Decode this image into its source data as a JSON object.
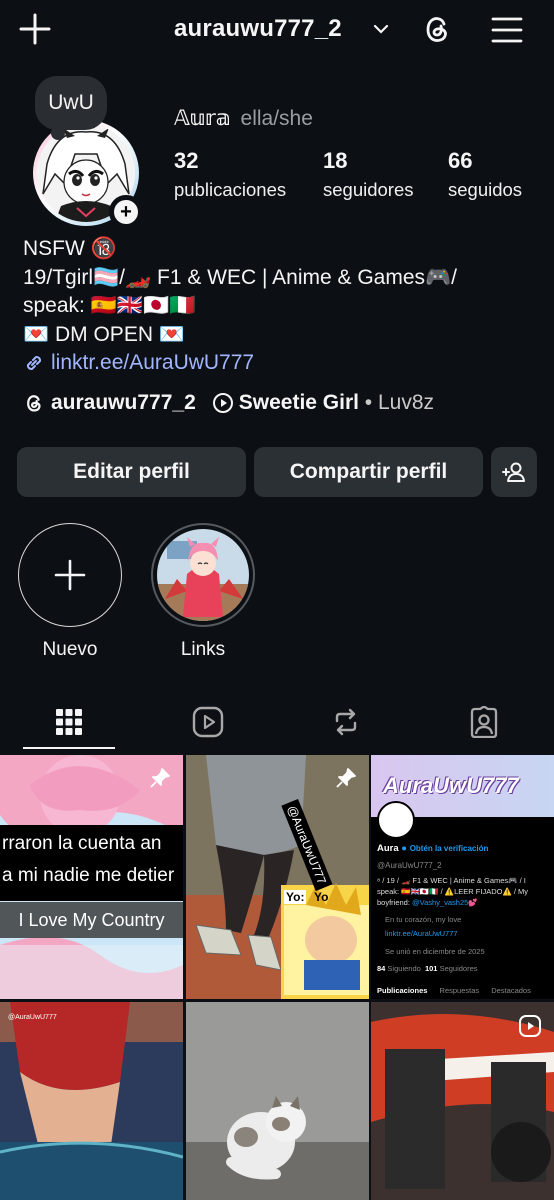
{
  "header": {
    "username": "aurauwu777_2"
  },
  "note": {
    "text": "UwU"
  },
  "profile": {
    "display_name": "𝔸𝕦𝕣𝕒",
    "pronouns": "ella/she"
  },
  "stats": [
    {
      "value": "32",
      "label": "publicaciones"
    },
    {
      "value": "18",
      "label": "seguidores"
    },
    {
      "value": "66",
      "label": "seguidos"
    }
  ],
  "bio": {
    "line1": "NSFW 🔞",
    "line2": "19/Tgirl🏳️‍⚧️/🏎️ F1 & WEC | Anime & Games🎮/",
    "line3": "speak: 🇪🇸🇬🇧🇯🇵🇮🇹",
    "line4": "💌 DM OPEN 💌",
    "link": "linktr.ee/AuraUwU777"
  },
  "meta": {
    "threads_handle": "aurauwu777_2",
    "song_title": "Sweetie Girl",
    "song_sep": " • ",
    "song_artist": "Luv8z"
  },
  "buttons": {
    "edit": "Editar perfil",
    "share": "Compartir perfil"
  },
  "highlights": [
    {
      "label": "Nuevo"
    },
    {
      "label": "Links"
    }
  ],
  "posts": {
    "p1_text1": "rraron la cuenta an",
    "p1_text2": "a mi nadie me detier",
    "p1_text3": "I Love My Country",
    "p2_watermark": "@AuraUwU777",
    "p2_yo1": "Yo:",
    "p2_yo2": "Yo",
    "p3_title": "AuraUwU777",
    "p3_name": "Aura",
    "p3_verify": "Obtén la verificación",
    "p3_handle": "@AuraUwU777_2",
    "p3_bio1": "⁸ / 19 / 🏎️ F1 & WEC | Anime & Games🎮 / I",
    "p3_bio2": "speak: 🇪🇸🇬🇧🇯🇵🇮🇹 / ⚠️LEER FIJADO⚠️ / My",
    "p3_bio3a": "boyfriend: ",
    "p3_bio3b": "@Vashy_vash25💕",
    "p3_loc": "En tu corazón, my love",
    "p3_link": "linktr.ee/AuraUwU777",
    "p3_joined": "Se unió en diciembre de 2025",
    "p3_follow_a": "84",
    "p3_follow_b": " Siguiendo  ",
    "p3_follow_c": "101",
    "p3_follow_d": " Seguidores",
    "p3_tab1": "Publicaciones",
    "p3_tab2": "Respuestas",
    "p3_tab3": "Destacados",
    "p4_watermark": "@AuraUwU777"
  }
}
